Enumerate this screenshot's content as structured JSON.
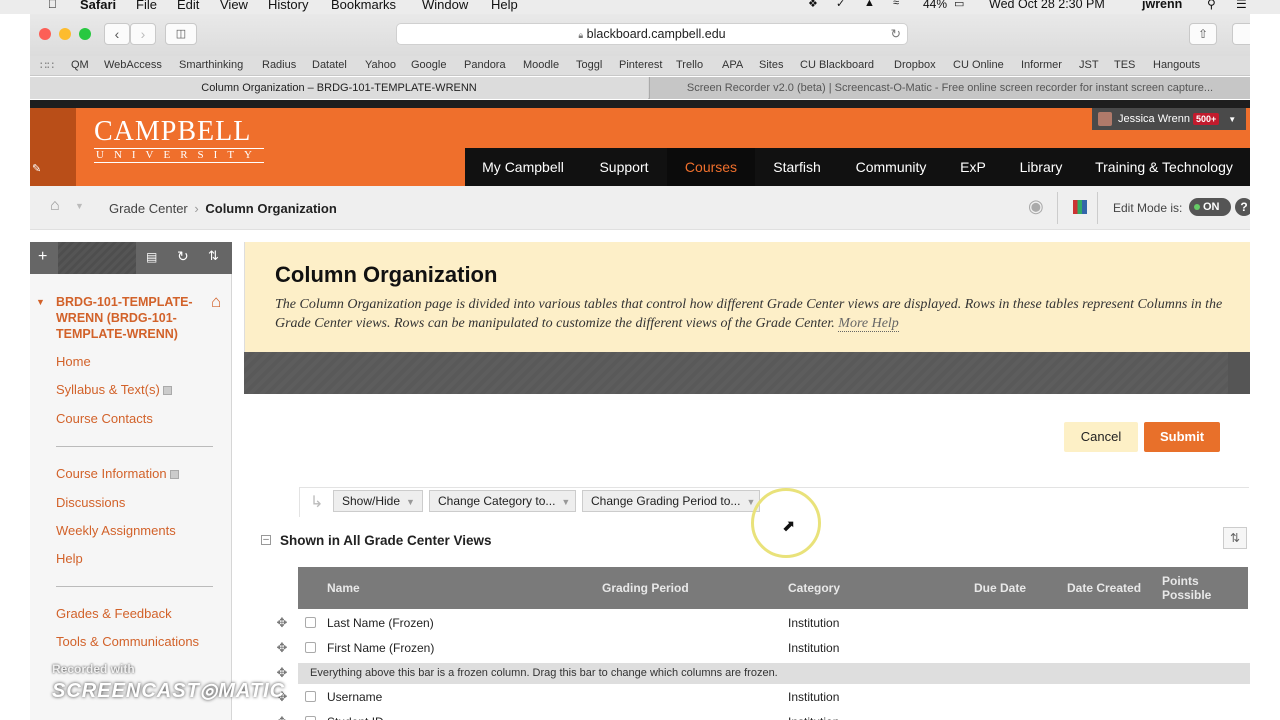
{
  "menubar": {
    "items": [
      "Safari",
      "File",
      "Edit",
      "View",
      "History",
      "Bookmarks",
      "Window",
      "Help"
    ],
    "battery": "44%",
    "clock": "Wed Oct 28  2:30 PM",
    "user": "jwrenn"
  },
  "browser": {
    "url": "blackboard.campbell.edu",
    "bookmarks": [
      "QM",
      "WebAccess",
      "Smarthinking",
      "Radius",
      "Datatel",
      "Yahoo",
      "Google",
      "Pandora",
      "Moodle",
      "Toggl",
      "Pinterest",
      "Trello",
      "APA",
      "Sites",
      "CU Blackboard",
      "Dropbox",
      "CU Online",
      "Informer",
      "JST",
      "TES",
      "Hangouts"
    ],
    "tabs": [
      {
        "title": "Column Organization – BRDG-101-TEMPLATE-WRENN"
      },
      {
        "title": "Screen Recorder v2.0 (beta) | Screencast-O-Matic - Free online screen recorder for instant screen capture..."
      }
    ]
  },
  "header": {
    "logo_main": "CAMPBELL",
    "logo_sub": "UNIVERSITY",
    "user_name": "Jessica Wrenn",
    "notifications": "500+",
    "nav": [
      "My Campbell",
      "Support",
      "Courses",
      "Starfish",
      "Community",
      "ExP",
      "Library",
      "Training & Technology"
    ],
    "active_nav": "Courses"
  },
  "breadcrumb": {
    "parent": "Grade Center",
    "current": "Column Organization",
    "edit_mode_label": "Edit Mode is:",
    "edit_mode_value": "ON"
  },
  "sidebar": {
    "course_title": "BRDG-101-TEMPLATE-WRENN (BRDG-101-TEMPLATE-WRENN)",
    "group1": [
      "Home",
      "Syllabus & Text(s)",
      "Course Contacts"
    ],
    "group2": [
      "Course Information",
      "Discussions",
      "Weekly Assignments",
      "Help"
    ],
    "group3": [
      "Grades & Feedback",
      "Tools & Communications"
    ]
  },
  "page": {
    "title": "Column Organization",
    "description": "The Column Organization page is divided into various tables that control how different Grade Center views are displayed. Rows in these tables represent Columns in the Grade Center views. Rows can be manipulated to customize the different views of the Grade Center.",
    "more_help": "More Help",
    "cancel_label": "Cancel",
    "submit_label": "Submit",
    "actions": [
      "Show/Hide",
      "Change Category to...",
      "Change Grading Period to..."
    ],
    "section_title": "Shown in All Grade Center Views"
  },
  "table": {
    "columns": [
      "Name",
      "Grading Period",
      "Category",
      "Due Date",
      "Date Created",
      "Points Possible"
    ],
    "rows": [
      {
        "name": "Last Name (Frozen)",
        "category": "Institution"
      },
      {
        "name": "First Name (Frozen)",
        "category": "Institution"
      },
      {
        "name": "Username",
        "category": "Institution"
      },
      {
        "name": "Student ID",
        "category": "Institution"
      }
    ],
    "frozen_bar": "Everything above this bar is a frozen column. Drag this bar to change which columns are frozen."
  },
  "watermark": {
    "line1": "Recorded with",
    "line2": "SCREENCAST◎MATIC"
  },
  "colors": {
    "brand_orange": "#ef6f2c",
    "nav_black": "#111111",
    "intro_yellow": "#fdefc8",
    "submit_orange": "#e8702a"
  }
}
